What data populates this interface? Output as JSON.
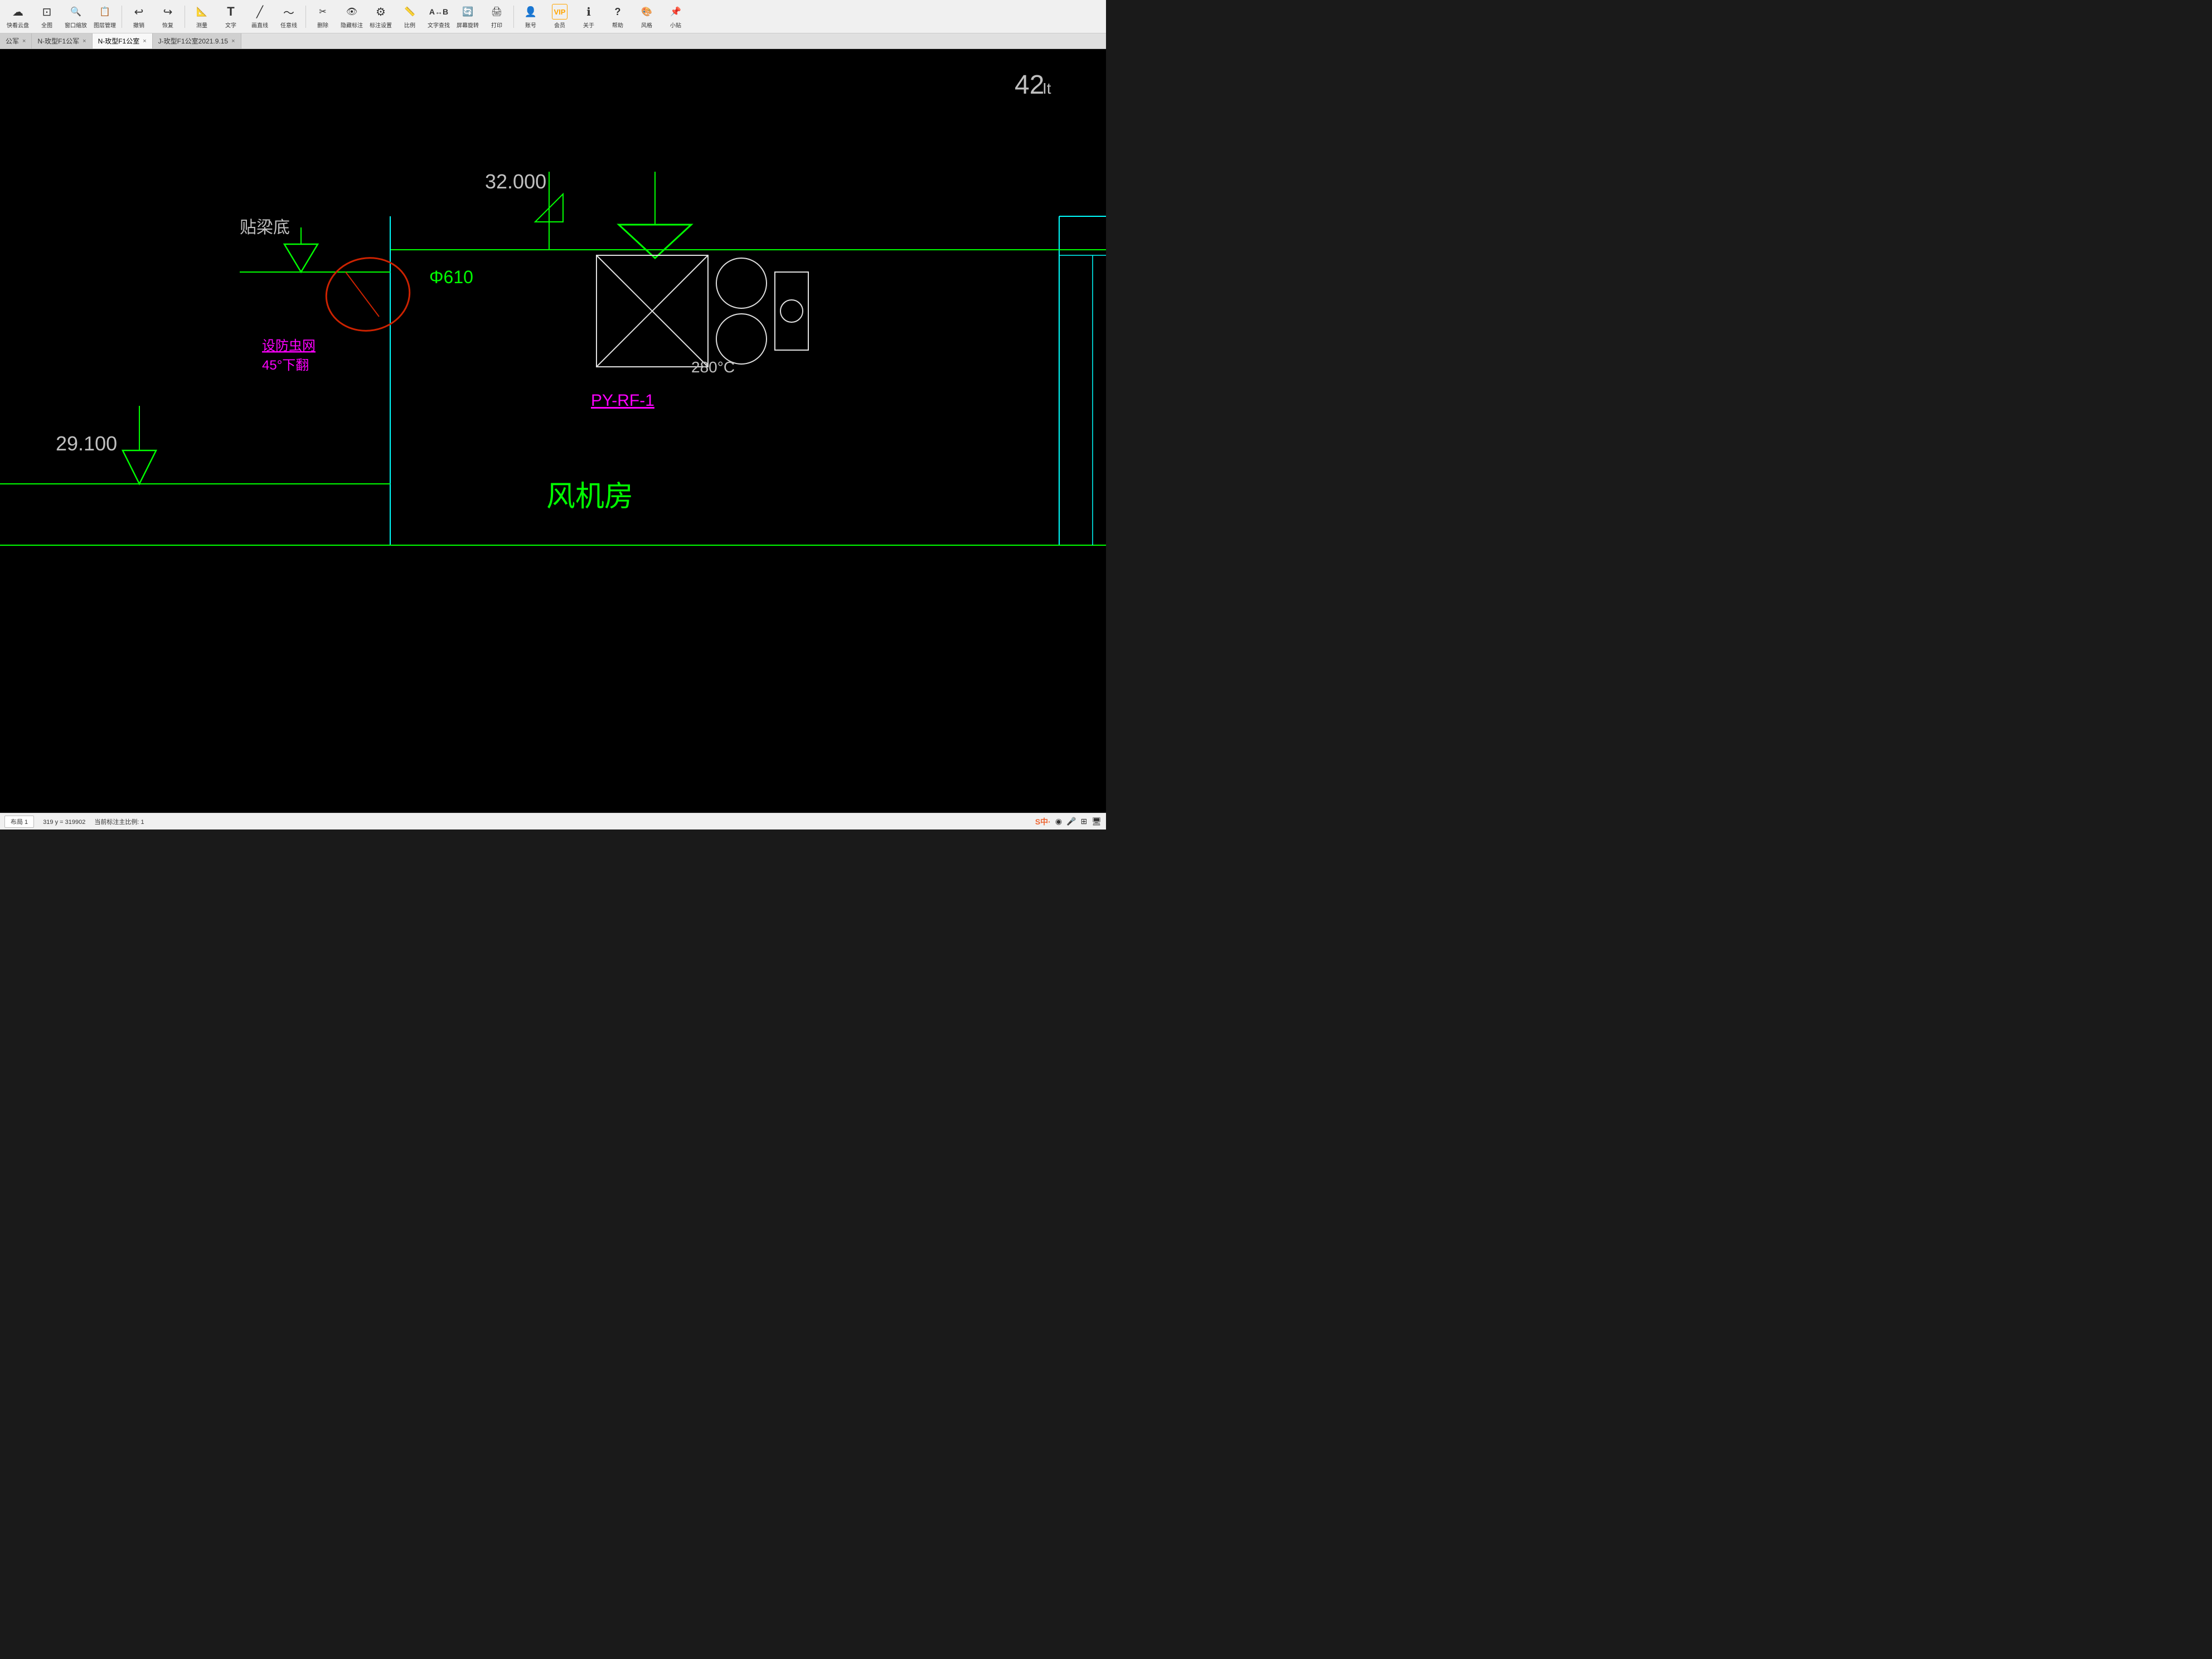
{
  "toolbar": {
    "items": [
      {
        "id": "cloud",
        "label": "快看云盘",
        "icon": "☁"
      },
      {
        "id": "full",
        "label": "全图",
        "icon": "⊡"
      },
      {
        "id": "zoom",
        "label": "窗口缩放",
        "icon": "🔍"
      },
      {
        "id": "layers",
        "label": "图层管理",
        "icon": "📋"
      },
      {
        "id": "undo",
        "label": "撤销",
        "icon": "↩"
      },
      {
        "id": "redo",
        "label": "恢复",
        "icon": "↪"
      },
      {
        "id": "measure",
        "label": "测量",
        "icon": "📐"
      },
      {
        "id": "text",
        "label": "文字",
        "icon": "T"
      },
      {
        "id": "line",
        "label": "画直线",
        "icon": "╱"
      },
      {
        "id": "freehand",
        "label": "任意线",
        "icon": "〜"
      },
      {
        "id": "edit",
        "label": "删除",
        "icon": "✂"
      },
      {
        "id": "hide",
        "label": "隐藏标注",
        "icon": "👁"
      },
      {
        "id": "markset",
        "label": "标注设置",
        "icon": "⚙"
      },
      {
        "id": "scale",
        "label": "比例",
        "icon": "📏"
      },
      {
        "id": "textcheck",
        "label": "文字查找",
        "icon": "🔤"
      },
      {
        "id": "screenshot",
        "label": "屏幕旋转",
        "icon": "🔄"
      },
      {
        "id": "print",
        "label": "打印",
        "icon": "🖨"
      },
      {
        "id": "account",
        "label": "账号",
        "icon": "👤"
      },
      {
        "id": "vip",
        "label": "会员",
        "icon": "VIP"
      },
      {
        "id": "info",
        "label": "关于",
        "icon": "ℹ"
      },
      {
        "id": "help",
        "label": "帮助",
        "icon": "?"
      },
      {
        "id": "style",
        "label": "风格",
        "icon": "🎨"
      },
      {
        "id": "plugin",
        "label": "小贴",
        "icon": "📌"
      }
    ]
  },
  "tabs": [
    {
      "id": "tab1",
      "label": "公军",
      "active": false,
      "closeable": true
    },
    {
      "id": "tab2",
      "label": "N-玫型F1公军",
      "active": false,
      "closeable": true
    },
    {
      "id": "tab3",
      "label": "N-玫型F1公室",
      "active": true,
      "closeable": true
    },
    {
      "id": "tab4",
      "label": "J-玫型F1公室2021.9.15",
      "active": false,
      "closeable": true
    }
  ],
  "drawing": {
    "elevation_top": "32.000",
    "elevation_bottom": "29.100",
    "label_beam": "贴梁底",
    "label_diameter": "Φ610",
    "label_insect": "设防虫网",
    "label_angle": "45°下翻",
    "label_fan_room": "风机房",
    "label_py": "PY-RF-1",
    "label_temp": "280°C",
    "coords": "319 y = 319902",
    "scale": "当前标注主比例: 1"
  },
  "statusbar": {
    "layout_tab": "布局 1",
    "scale_label": "当前标注主比例: 1",
    "coords": "319 y = 319902",
    "right_icons": [
      "S中·",
      "◉",
      "🎤",
      "⊞",
      "🖥"
    ]
  }
}
